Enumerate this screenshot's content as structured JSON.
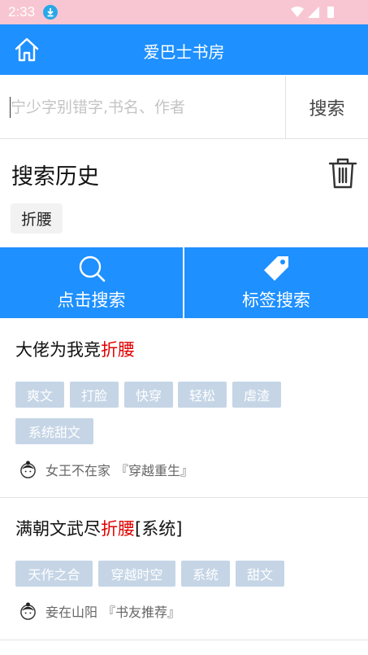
{
  "status_bar": {
    "time": "2:33"
  },
  "app_bar": {
    "title": "爱巴士书房"
  },
  "search": {
    "placeholder": "宁少字别错字,书名、作者",
    "button_label": "搜索"
  },
  "history": {
    "title": "搜索历史",
    "items": [
      "折腰"
    ]
  },
  "actions": {
    "click_search": "点击搜索",
    "tag_search": "标签搜索"
  },
  "books": [
    {
      "title_prefix": "大佬为我竞",
      "title_highlight": "折腰",
      "title_suffix": "",
      "tags": [
        "爽文",
        "打脸",
        "快穿",
        "轻松",
        "虐渣",
        "系统甜文"
      ],
      "author": "女王不在家",
      "category": "『穿越重生』"
    },
    {
      "title_prefix": "满朝文武尽",
      "title_highlight": "折腰",
      "title_suffix": "[系统]",
      "tags": [
        "天作之合",
        "穿越时空",
        "系统",
        "甜文"
      ],
      "author": "妾在山阳",
      "category": "『书友推荐』"
    }
  ],
  "colors": {
    "primary": "#1e90ff",
    "status_bar": "#f8c6d2",
    "highlight": "#e00000",
    "tag_bg": "#c5d5e6"
  }
}
